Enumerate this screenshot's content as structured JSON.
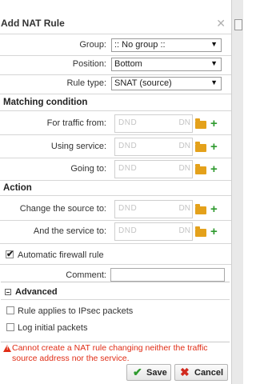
{
  "dialog": {
    "title": "Add NAT Rule",
    "close_glyph": "✕"
  },
  "fields": {
    "group": {
      "label": "Group:",
      "value": ":: No group ::"
    },
    "position": {
      "label": "Position:",
      "value": "Bottom"
    },
    "rule_type": {
      "label": "Rule type:",
      "value": "SNAT (source)"
    }
  },
  "matching": {
    "title": "Matching condition",
    "rows": [
      {
        "label": "For traffic from:",
        "placeholder": "DND",
        "suffix": "DN"
      },
      {
        "label": "Using service:",
        "placeholder": "DND",
        "suffix": "DN"
      },
      {
        "label": "Going to:",
        "placeholder": "DND",
        "suffix": "DN"
      }
    ]
  },
  "action": {
    "title": "Action",
    "rows": [
      {
        "label": "Change the source to:",
        "placeholder": "DND",
        "suffix": "DN"
      },
      {
        "label": "And the service to:",
        "placeholder": "DND",
        "suffix": "DN"
      }
    ]
  },
  "auto_firewall": {
    "label": "Automatic firewall rule",
    "checked": true
  },
  "comment": {
    "label": "Comment:",
    "value": ""
  },
  "advanced": {
    "title": "Advanced",
    "options": [
      {
        "label": "Rule applies to IPsec packets",
        "checked": false
      },
      {
        "label": "Log initial packets",
        "checked": false
      }
    ]
  },
  "warning": {
    "text": "Cannot create a NAT rule changing neither the traffic source address nor the service."
  },
  "buttons": {
    "save": "Save",
    "cancel": "Cancel"
  },
  "icons": {
    "dropdown": "dropdown-arrow-icon",
    "folder": "folder-icon",
    "add": "add-icon",
    "warning": "warning-icon",
    "save": "checkmark-icon",
    "cancel": "cancel-x-icon"
  },
  "colors": {
    "warning": "#e02d16",
    "add": "#2e9a2e",
    "folder": "#e4a11b",
    "cancel": "#d12a1f"
  }
}
